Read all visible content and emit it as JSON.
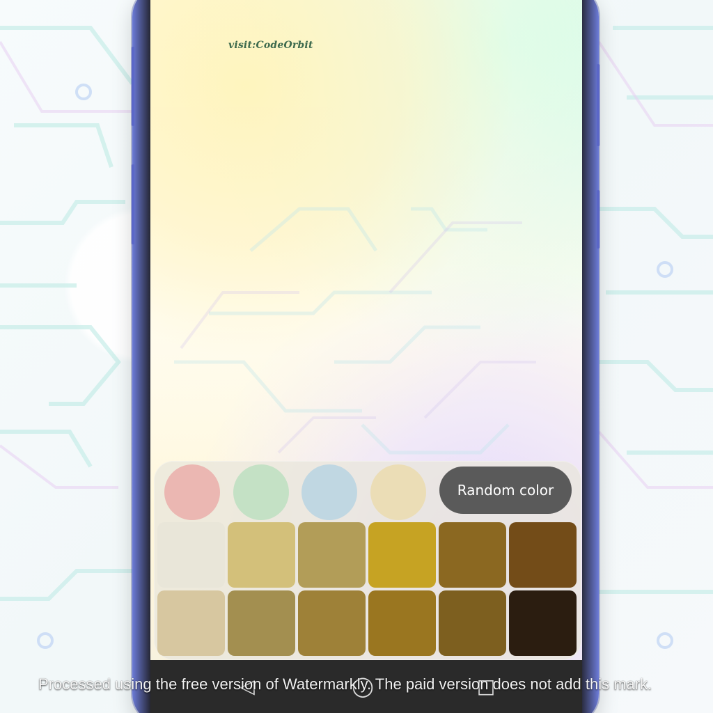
{
  "app": {
    "brand_text": "visit:CodeOrbit"
  },
  "controls": {
    "random_button_label": "Random color"
  },
  "color_buttons": [
    {
      "name": "red",
      "color": "#f0202d"
    },
    {
      "name": "green",
      "color": "#4fd17a"
    },
    {
      "name": "blue",
      "color": "#3ea7f4"
    },
    {
      "name": "yellow",
      "color": "#f2c13c"
    }
  ],
  "swatches": [
    "#e9e6d9",
    "#d3c07a",
    "#b29d58",
    "#c6a323",
    "#8b6821",
    "#734c18",
    "#d7c7a0",
    "#a38f50",
    "#9e8138",
    "#9a7620",
    "#7d5f1f",
    "#2b1d10"
  ],
  "nav_icons": [
    {
      "name": "back",
      "glyph": "◁"
    },
    {
      "name": "home",
      "glyph": "◯"
    },
    {
      "name": "recents",
      "glyph": "□"
    }
  ],
  "watermark": {
    "text": "Processed using the free version of Watermarkly. The paid version does not add this mark."
  }
}
